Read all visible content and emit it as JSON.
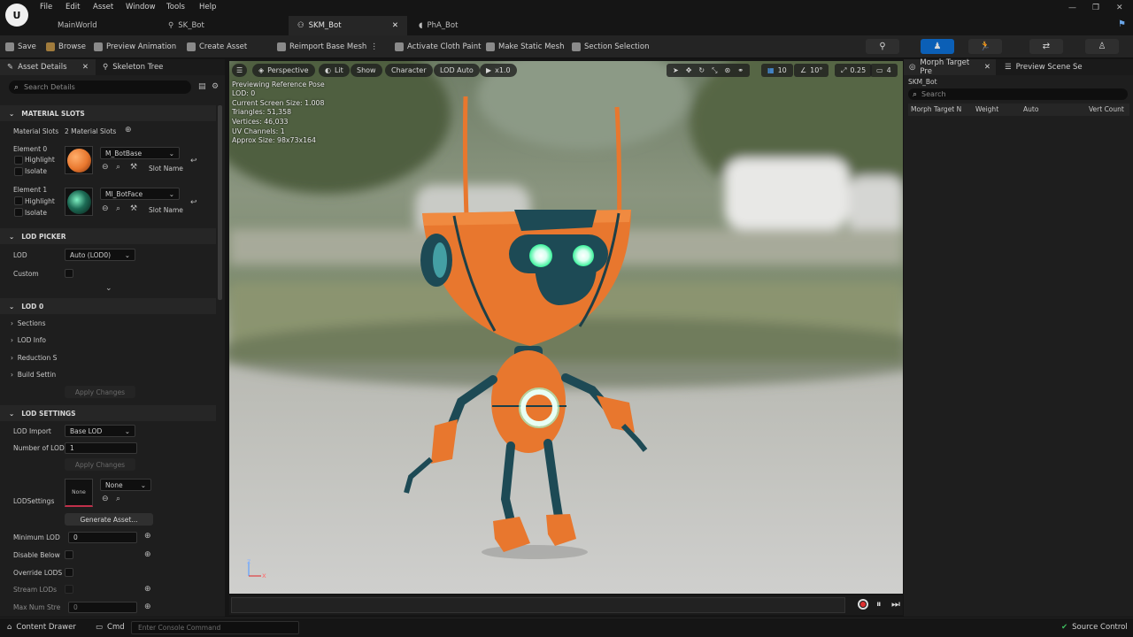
{
  "menu": {
    "items": [
      "File",
      "Edit",
      "Asset",
      "Window",
      "Tools",
      "Help"
    ]
  },
  "tabs": [
    {
      "label": "MainWorld"
    },
    {
      "label": "SK_Bot"
    },
    {
      "label": "SKM_Bot"
    },
    {
      "label": "PhA_Bot"
    }
  ],
  "toolbar": {
    "save": "Save",
    "browse": "Browse",
    "preview_animation": "Preview Animation",
    "create_asset": "Create Asset",
    "reimport": "Reimport Base Mesh",
    "cloth_paint": "Activate Cloth Paint",
    "make_static": "Make Static Mesh",
    "section_selection": "Section Selection"
  },
  "left_panel": {
    "tabs": [
      "Asset Details",
      "Skeleton Tree"
    ],
    "search_placeholder": "Search Details",
    "material_slots": {
      "header": "MATERIAL SLOTS",
      "label": "Material Slots",
      "count": "2 Material Slots",
      "elements": [
        {
          "name": "Element 0",
          "highlight": "Highlight",
          "isolate": "Isolate",
          "material": "M_BotBase",
          "slot_name": "Slot Name"
        },
        {
          "name": "Element 1",
          "highlight": "Highlight",
          "isolate": "Isolate",
          "material": "MI_BotFace",
          "slot_name": "Slot Name"
        }
      ]
    },
    "lod_picker": {
      "header": "LOD PICKER",
      "lod_label": "LOD",
      "lod_value": "Auto (LOD0)",
      "custom_label": "Custom"
    },
    "lod0": {
      "header": "LOD 0",
      "items": [
        "Sections",
        "LOD Info",
        "Reduction S",
        "Build Settin"
      ],
      "apply": "Apply Changes"
    },
    "lod_settings": {
      "header": "LOD SETTINGS",
      "lod_import_label": "LOD Import",
      "lod_import_value": "Base LOD",
      "num_lod_label": "Number of LOD",
      "num_lod_value": "1",
      "apply": "Apply Changes",
      "lodsettings_label": "LODSettings",
      "thumb_none": "None",
      "lodsettings_value": "None",
      "generate": "Generate Asset...",
      "min_lod_label": "Minimum LOD",
      "min_lod_value": "0",
      "disable_below_label": "Disable Below",
      "override_lods_label": "Override LODS",
      "stream_lods_label": "Stream LODs",
      "max_num_label": "Max Num Stre",
      "max_num_value": "0"
    }
  },
  "viewport": {
    "toolbar": {
      "perspective": "Perspective",
      "lit": "Lit",
      "show": "Show",
      "character": "Character",
      "lod": "LOD Auto",
      "speed": "x1.0"
    },
    "right_toolbar": {
      "grid": "10",
      "angle": "10°",
      "scale": "0.25",
      "camera": "4"
    },
    "overlay": [
      "Previewing Reference Pose",
      "LOD: 0",
      "Current Screen Size: 1.008",
      "Triangles: 51,358",
      "Vertices: 46,033",
      "UV Channels: 1",
      "Approx Size: 98x73x164"
    ],
    "axis_z": "z",
    "axis_x": "x"
  },
  "right_panel": {
    "tabs": [
      "Morph Target Pre",
      "Preview Scene Se"
    ],
    "asset": "SKM_Bot",
    "search_placeholder": "Search",
    "columns": [
      "Morph Target N",
      "Weight",
      "Auto",
      "Vert Count"
    ]
  },
  "status": {
    "content_drawer": "Content Drawer",
    "cmd": "Cmd",
    "console_placeholder": "Enter Console Command",
    "source_control": "Source Control"
  },
  "colors": {
    "accent": "#0b5fb6",
    "robot_orange": "#e8772e",
    "robot_teal": "#1d4a55",
    "eye_green": "#39f29a"
  }
}
